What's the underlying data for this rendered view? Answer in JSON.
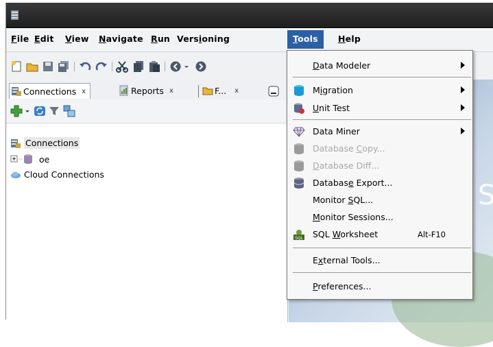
{
  "menubar": {
    "items": [
      {
        "pre": "",
        "u": "F",
        "post": "ile"
      },
      {
        "pre": "",
        "u": "E",
        "post": "dit"
      },
      {
        "pre": "",
        "u": "V",
        "post": "iew"
      },
      {
        "pre": "",
        "u": "N",
        "post": "avigate"
      },
      {
        "pre": "",
        "u": "R",
        "post": "un"
      },
      {
        "pre": "Vers",
        "u": "i",
        "post": "oning"
      },
      {
        "pre": "",
        "u": "T",
        "post": "ools"
      },
      {
        "pre": "",
        "u": "H",
        "post": "elp"
      }
    ]
  },
  "tabs": {
    "connections": "Connections",
    "reports": "Reports",
    "files": "F...",
    "close_glyph": "x"
  },
  "tree": {
    "root": "Connections",
    "child": "oe",
    "cloud": "Cloud Connections"
  },
  "tools_menu": {
    "data_modeler": {
      "pre": "",
      "u": "D",
      "post": "ata Modeler"
    },
    "migration": {
      "pre": "M",
      "u": "i",
      "post": "gration"
    },
    "unit_test": {
      "pre": "",
      "u": "U",
      "post": "nit Test"
    },
    "data_miner": {
      "pre": "Data Miner",
      "u": "",
      "post": ""
    },
    "database_copy": {
      "pre": "Database ",
      "u": "C",
      "post": "opy..."
    },
    "database_diff": {
      "pre": "",
      "u": "D",
      "post": "atabase Diff..."
    },
    "database_export": {
      "pre": "Databas",
      "u": "e",
      "post": " Export..."
    },
    "monitor_sql": {
      "pre": "Monitor ",
      "u": "S",
      "post": "QL..."
    },
    "monitor_sessions": {
      "pre": "",
      "u": "M",
      "post": "onitor Sessions..."
    },
    "sql_worksheet": {
      "pre": "SQL ",
      "u": "W",
      "post": "orksheet"
    },
    "sql_worksheet_accel": "Alt-F10",
    "external_tools": {
      "pre": "E",
      "u": "x",
      "post": "ternal Tools..."
    },
    "preferences": {
      "pre": "",
      "u": "P",
      "post": "references..."
    }
  }
}
